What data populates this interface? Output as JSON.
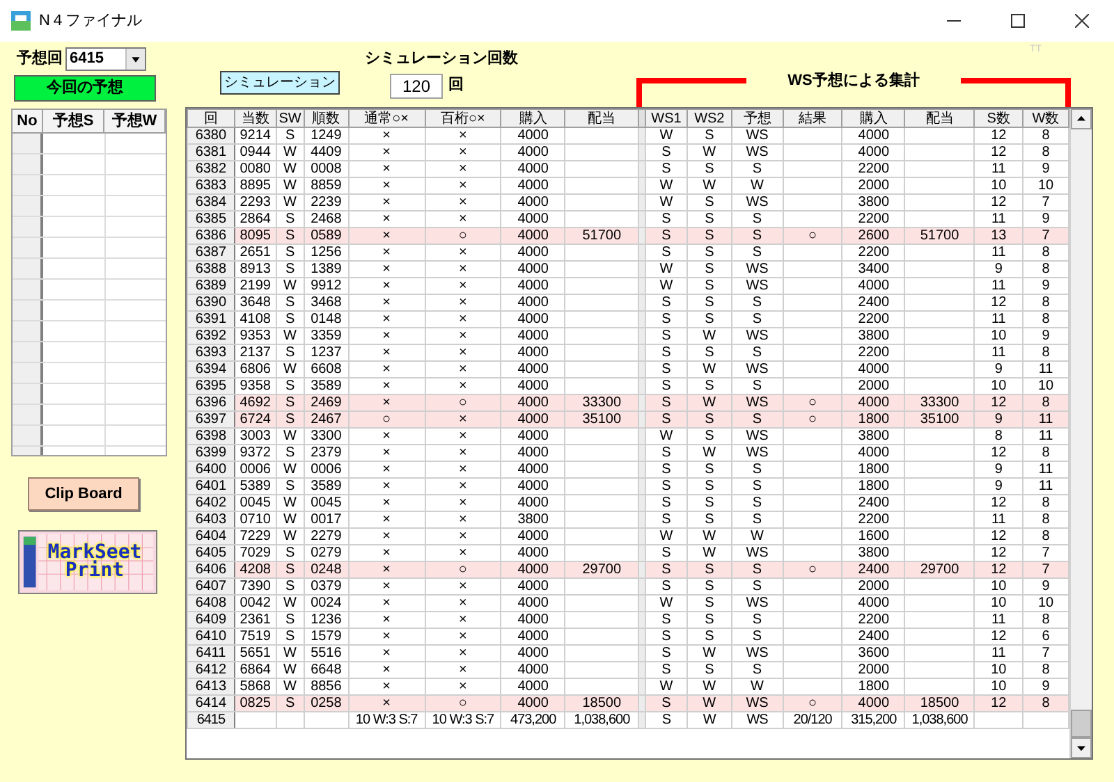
{
  "window": {
    "title": "N４ファイナル",
    "corner_label": "TT"
  },
  "round_select": {
    "label": "予想回",
    "value": "6415"
  },
  "predict_button": "今回の予想",
  "prediction_table": {
    "columns": [
      "No",
      "予想S",
      "予想W"
    ]
  },
  "clipboard_button": "Clip Board",
  "markseet_button": [
    "MarkSeet",
    "Print"
  ],
  "simulation_button": "シミュレーション",
  "simulation_count": {
    "label": "シミュレーション回数",
    "value": "120",
    "unit": "回"
  },
  "ws_summary_title": "WS予想による集計",
  "results_table": {
    "columns_left": [
      "回",
      "当数",
      "SW",
      "順数",
      "通常○×",
      "百桁○×",
      "購入",
      "配当"
    ],
    "columns_right": [
      "WS1",
      "WS2",
      "予想",
      "結果",
      "購入",
      "配当",
      "S数",
      "W数"
    ],
    "rows": [
      {
        "highlighted": false,
        "left": {
          "round": "6380",
          "winning_number": "9214",
          "sw": "S",
          "sorted_number": "1249",
          "normal_hit": "×",
          "hundreds_hit": "×",
          "purchase": "4000"
        },
        "right": {
          "ws1": "W",
          "ws2": "S",
          "forecast": "WS",
          "purchase": "4000",
          "s_count": "12",
          "w_count": "8"
        }
      },
      {
        "highlighted": false,
        "left": {
          "round": "6381",
          "winning_number": "0944",
          "sw": "W",
          "sorted_number": "4409",
          "normal_hit": "×",
          "hundreds_hit": "×",
          "purchase": "4000"
        },
        "right": {
          "ws1": "S",
          "ws2": "W",
          "forecast": "WS",
          "purchase": "4000",
          "s_count": "12",
          "w_count": "8"
        }
      },
      {
        "highlighted": false,
        "left": {
          "round": "6382",
          "winning_number": "0080",
          "sw": "W",
          "sorted_number": "0008",
          "normal_hit": "×",
          "hundreds_hit": "×",
          "purchase": "4000"
        },
        "right": {
          "ws1": "S",
          "ws2": "S",
          "forecast": "S",
          "purchase": "2200",
          "s_count": "11",
          "w_count": "9"
        }
      },
      {
        "highlighted": false,
        "left": {
          "round": "6383",
          "winning_number": "8895",
          "sw": "W",
          "sorted_number": "8859",
          "normal_hit": "×",
          "hundreds_hit": "×",
          "purchase": "4000"
        },
        "right": {
          "ws1": "W",
          "ws2": "W",
          "forecast": "W",
          "purchase": "2000",
          "s_count": "10",
          "w_count": "10"
        }
      },
      {
        "highlighted": false,
        "left": {
          "round": "6384",
          "winning_number": "2293",
          "sw": "W",
          "sorted_number": "2239",
          "normal_hit": "×",
          "hundreds_hit": "×",
          "purchase": "4000"
        },
        "right": {
          "ws1": "W",
          "ws2": "S",
          "forecast": "WS",
          "purchase": "3800",
          "s_count": "12",
          "w_count": "7"
        }
      },
      {
        "highlighted": false,
        "left": {
          "round": "6385",
          "winning_number": "2864",
          "sw": "S",
          "sorted_number": "2468",
          "normal_hit": "×",
          "hundreds_hit": "×",
          "purchase": "4000"
        },
        "right": {
          "ws1": "S",
          "ws2": "S",
          "forecast": "S",
          "purchase": "2200",
          "s_count": "11",
          "w_count": "9"
        }
      },
      {
        "highlighted": true,
        "left": {
          "round": "6386",
          "winning_number": "8095",
          "sw": "S",
          "sorted_number": "0589",
          "normal_hit": "×",
          "hundreds_hit": "○",
          "purchase": "4000",
          "payout": "51700"
        },
        "right": {
          "ws1": "S",
          "ws2": "S",
          "forecast": "S",
          "result": "○",
          "purchase": "2600",
          "payout": "51700",
          "s_count": "13",
          "w_count": "7"
        }
      },
      {
        "highlighted": false,
        "left": {
          "round": "6387",
          "winning_number": "2651",
          "sw": "S",
          "sorted_number": "1256",
          "normal_hit": "×",
          "hundreds_hit": "×",
          "purchase": "4000"
        },
        "right": {
          "ws1": "S",
          "ws2": "S",
          "forecast": "S",
          "purchase": "2200",
          "s_count": "11",
          "w_count": "8"
        }
      },
      {
        "highlighted": false,
        "left": {
          "round": "6388",
          "winning_number": "8913",
          "sw": "S",
          "sorted_number": "1389",
          "normal_hit": "×",
          "hundreds_hit": "×",
          "purchase": "4000"
        },
        "right": {
          "ws1": "W",
          "ws2": "S",
          "forecast": "WS",
          "purchase": "3400",
          "s_count": "9",
          "w_count": "8"
        }
      },
      {
        "highlighted": false,
        "left": {
          "round": "6389",
          "winning_number": "2199",
          "sw": "W",
          "sorted_number": "9912",
          "normal_hit": "×",
          "hundreds_hit": "×",
          "purchase": "4000"
        },
        "right": {
          "ws1": "W",
          "ws2": "S",
          "forecast": "WS",
          "purchase": "4000",
          "s_count": "11",
          "w_count": "9"
        }
      },
      {
        "highlighted": false,
        "left": {
          "round": "6390",
          "winning_number": "3648",
          "sw": "S",
          "sorted_number": "3468",
          "normal_hit": "×",
          "hundreds_hit": "×",
          "purchase": "4000"
        },
        "right": {
          "ws1": "S",
          "ws2": "S",
          "forecast": "S",
          "purchase": "2400",
          "s_count": "12",
          "w_count": "8"
        }
      },
      {
        "highlighted": false,
        "left": {
          "round": "6391",
          "winning_number": "4108",
          "sw": "S",
          "sorted_number": "0148",
          "normal_hit": "×",
          "hundreds_hit": "×",
          "purchase": "4000"
        },
        "right": {
          "ws1": "S",
          "ws2": "S",
          "forecast": "S",
          "purchase": "2200",
          "s_count": "11",
          "w_count": "8"
        }
      },
      {
        "highlighted": false,
        "left": {
          "round": "6392",
          "winning_number": "9353",
          "sw": "W",
          "sorted_number": "3359",
          "normal_hit": "×",
          "hundreds_hit": "×",
          "purchase": "4000"
        },
        "right": {
          "ws1": "S",
          "ws2": "W",
          "forecast": "WS",
          "purchase": "3800",
          "s_count": "10",
          "w_count": "9"
        }
      },
      {
        "highlighted": false,
        "left": {
          "round": "6393",
          "winning_number": "2137",
          "sw": "S",
          "sorted_number": "1237",
          "normal_hit": "×",
          "hundreds_hit": "×",
          "purchase": "4000"
        },
        "right": {
          "ws1": "S",
          "ws2": "S",
          "forecast": "S",
          "purchase": "2200",
          "s_count": "11",
          "w_count": "8"
        }
      },
      {
        "highlighted": false,
        "left": {
          "round": "6394",
          "winning_number": "6806",
          "sw": "W",
          "sorted_number": "6608",
          "normal_hit": "×",
          "hundreds_hit": "×",
          "purchase": "4000"
        },
        "right": {
          "ws1": "S",
          "ws2": "W",
          "forecast": "WS",
          "purchase": "4000",
          "s_count": "9",
          "w_count": "11"
        }
      },
      {
        "highlighted": false,
        "left": {
          "round": "6395",
          "winning_number": "9358",
          "sw": "S",
          "sorted_number": "3589",
          "normal_hit": "×",
          "hundreds_hit": "×",
          "purchase": "4000"
        },
        "right": {
          "ws1": "S",
          "ws2": "S",
          "forecast": "S",
          "purchase": "2000",
          "s_count": "10",
          "w_count": "10"
        }
      },
      {
        "highlighted": true,
        "left": {
          "round": "6396",
          "winning_number": "4692",
          "sw": "S",
          "sorted_number": "2469",
          "normal_hit": "×",
          "hundreds_hit": "○",
          "purchase": "4000",
          "payout": "33300"
        },
        "right": {
          "ws1": "S",
          "ws2": "W",
          "forecast": "WS",
          "result": "○",
          "purchase": "4000",
          "payout": "33300",
          "s_count": "12",
          "w_count": "8"
        }
      },
      {
        "highlighted": true,
        "left": {
          "round": "6397",
          "winning_number": "6724",
          "sw": "S",
          "sorted_number": "2467",
          "normal_hit": "○",
          "hundreds_hit": "×",
          "purchase": "4000",
          "payout": "35100"
        },
        "right": {
          "ws1": "S",
          "ws2": "S",
          "forecast": "S",
          "result": "○",
          "purchase": "1800",
          "payout": "35100",
          "s_count": "9",
          "w_count": "11"
        }
      },
      {
        "highlighted": false,
        "left": {
          "round": "6398",
          "winning_number": "3003",
          "sw": "W",
          "sorted_number": "3300",
          "normal_hit": "×",
          "hundreds_hit": "×",
          "purchase": "4000"
        },
        "right": {
          "ws1": "W",
          "ws2": "S",
          "forecast": "WS",
          "purchase": "3800",
          "s_count": "8",
          "w_count": "11"
        }
      },
      {
        "highlighted": false,
        "left": {
          "round": "6399",
          "winning_number": "9372",
          "sw": "S",
          "sorted_number": "2379",
          "normal_hit": "×",
          "hundreds_hit": "×",
          "purchase": "4000"
        },
        "right": {
          "ws1": "S",
          "ws2": "W",
          "forecast": "WS",
          "purchase": "4000",
          "s_count": "12",
          "w_count": "8"
        }
      },
      {
        "highlighted": false,
        "left": {
          "round": "6400",
          "winning_number": "0006",
          "sw": "W",
          "sorted_number": "0006",
          "normal_hit": "×",
          "hundreds_hit": "×",
          "purchase": "4000"
        },
        "right": {
          "ws1": "S",
          "ws2": "S",
          "forecast": "S",
          "purchase": "1800",
          "s_count": "9",
          "w_count": "11"
        }
      },
      {
        "highlighted": false,
        "left": {
          "round": "6401",
          "winning_number": "5389",
          "sw": "S",
          "sorted_number": "3589",
          "normal_hit": "×",
          "hundreds_hit": "×",
          "purchase": "4000"
        },
        "right": {
          "ws1": "S",
          "ws2": "S",
          "forecast": "S",
          "purchase": "1800",
          "s_count": "9",
          "w_count": "11"
        }
      },
      {
        "highlighted": false,
        "left": {
          "round": "6402",
          "winning_number": "0045",
          "sw": "W",
          "sorted_number": "0045",
          "normal_hit": "×",
          "hundreds_hit": "×",
          "purchase": "4000"
        },
        "right": {
          "ws1": "S",
          "ws2": "S",
          "forecast": "S",
          "purchase": "2400",
          "s_count": "12",
          "w_count": "8"
        }
      },
      {
        "highlighted": false,
        "left": {
          "round": "6403",
          "winning_number": "0710",
          "sw": "W",
          "sorted_number": "0017",
          "normal_hit": "×",
          "hundreds_hit": "×",
          "purchase": "3800"
        },
        "right": {
          "ws1": "S",
          "ws2": "S",
          "forecast": "S",
          "purchase": "2200",
          "s_count": "11",
          "w_count": "8"
        }
      },
      {
        "highlighted": false,
        "left": {
          "round": "6404",
          "winning_number": "7229",
          "sw": "W",
          "sorted_number": "2279",
          "normal_hit": "×",
          "hundreds_hit": "×",
          "purchase": "4000"
        },
        "right": {
          "ws1": "W",
          "ws2": "W",
          "forecast": "W",
          "purchase": "1600",
          "s_count": "12",
          "w_count": "8"
        }
      },
      {
        "highlighted": false,
        "left": {
          "round": "6405",
          "winning_number": "7029",
          "sw": "S",
          "sorted_number": "0279",
          "normal_hit": "×",
          "hundreds_hit": "×",
          "purchase": "4000"
        },
        "right": {
          "ws1": "S",
          "ws2": "W",
          "forecast": "WS",
          "purchase": "3800",
          "s_count": "12",
          "w_count": "7"
        }
      },
      {
        "highlighted": true,
        "left": {
          "round": "6406",
          "winning_number": "4208",
          "sw": "S",
          "sorted_number": "0248",
          "normal_hit": "×",
          "hundreds_hit": "○",
          "purchase": "4000",
          "payout": "29700"
        },
        "right": {
          "ws1": "S",
          "ws2": "S",
          "forecast": "S",
          "result": "○",
          "purchase": "2400",
          "payout": "29700",
          "s_count": "12",
          "w_count": "7"
        }
      },
      {
        "highlighted": false,
        "left": {
          "round": "6407",
          "winning_number": "7390",
          "sw": "S",
          "sorted_number": "0379",
          "normal_hit": "×",
          "hundreds_hit": "×",
          "purchase": "4000"
        },
        "right": {
          "ws1": "S",
          "ws2": "S",
          "forecast": "S",
          "purchase": "2000",
          "s_count": "10",
          "w_count": "9"
        }
      },
      {
        "highlighted": false,
        "left": {
          "round": "6408",
          "winning_number": "0042",
          "sw": "W",
          "sorted_number": "0024",
          "normal_hit": "×",
          "hundreds_hit": "×",
          "purchase": "4000"
        },
        "right": {
          "ws1": "W",
          "ws2": "S",
          "forecast": "WS",
          "purchase": "4000",
          "s_count": "10",
          "w_count": "10"
        }
      },
      {
        "highlighted": false,
        "left": {
          "round": "6409",
          "winning_number": "2361",
          "sw": "S",
          "sorted_number": "1236",
          "normal_hit": "×",
          "hundreds_hit": "×",
          "purchase": "4000"
        },
        "right": {
          "ws1": "S",
          "ws2": "S",
          "forecast": "S",
          "purchase": "2200",
          "s_count": "11",
          "w_count": "8"
        }
      },
      {
        "highlighted": false,
        "left": {
          "round": "6410",
          "winning_number": "7519",
          "sw": "S",
          "sorted_number": "1579",
          "normal_hit": "×",
          "hundreds_hit": "×",
          "purchase": "4000"
        },
        "right": {
          "ws1": "S",
          "ws2": "S",
          "forecast": "S",
          "purchase": "2400",
          "s_count": "12",
          "w_count": "6"
        }
      },
      {
        "highlighted": false,
        "left": {
          "round": "6411",
          "winning_number": "5651",
          "sw": "W",
          "sorted_number": "5516",
          "normal_hit": "×",
          "hundreds_hit": "×",
          "purchase": "4000"
        },
        "right": {
          "ws1": "S",
          "ws2": "W",
          "forecast": "WS",
          "purchase": "3600",
          "s_count": "11",
          "w_count": "7"
        }
      },
      {
        "highlighted": false,
        "left": {
          "round": "6412",
          "winning_number": "6864",
          "sw": "W",
          "sorted_number": "6648",
          "normal_hit": "×",
          "hundreds_hit": "×",
          "purchase": "4000"
        },
        "right": {
          "ws1": "S",
          "ws2": "S",
          "forecast": "S",
          "purchase": "2000",
          "s_count": "10",
          "w_count": "8"
        }
      },
      {
        "highlighted": false,
        "left": {
          "round": "6413",
          "winning_number": "5868",
          "sw": "W",
          "sorted_number": "8856",
          "normal_hit": "×",
          "hundreds_hit": "×",
          "purchase": "4000"
        },
        "right": {
          "ws1": "W",
          "ws2": "W",
          "forecast": "W",
          "purchase": "1800",
          "s_count": "10",
          "w_count": "9"
        }
      },
      {
        "highlighted": true,
        "left": {
          "round": "6414",
          "winning_number": "0825",
          "sw": "S",
          "sorted_number": "0258",
          "normal_hit": "×",
          "hundreds_hit": "○",
          "purchase": "4000",
          "payout": "18500"
        },
        "right": {
          "ws1": "S",
          "ws2": "W",
          "forecast": "WS",
          "result": "○",
          "purchase": "4000",
          "payout": "18500",
          "s_count": "12",
          "w_count": "8"
        }
      }
    ],
    "total": {
      "left": {
        "round": "6415",
        "normal_hit": "10 W:3 S:7",
        "hundreds_hit": "10 W:3 S:7",
        "purchase": "473,200",
        "payout": "1,038,600"
      },
      "right": {
        "ws1": "S",
        "ws2": "W",
        "forecast": "WS",
        "result": "20/120",
        "purchase": "315,200",
        "payout": "1,038,600"
      }
    }
  }
}
